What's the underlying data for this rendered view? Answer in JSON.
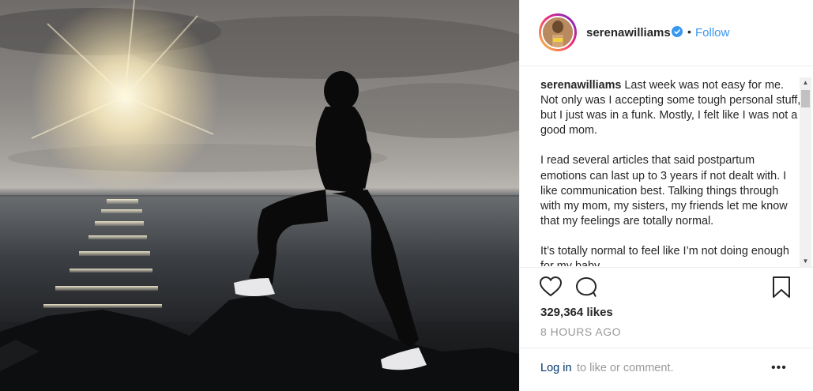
{
  "post": {
    "username": "serenawilliams",
    "follow_label": "Follow",
    "dot": "•",
    "caption": "Last week was not easy for me. Not only was I accepting some tough personal stuff, but I just was in a funk. Mostly, I felt like I was not a good mom.\n\nI read several articles that said postpartum emotions can last up to 3 years if not dealt with. I like communication best. Talking things through with my mom, my sisters, my friends let me know that my feelings are totally normal.\n\nIt’s totally normal to feel like I’m not doing enough for my baby.",
    "likes": "329,364 likes",
    "time_ago": "8 HOURS AGO"
  },
  "footer": {
    "login_link": "Log in",
    "login_rest": "to like or comment.",
    "more_label": "•••"
  },
  "icons": {
    "like": "heart-icon",
    "comment": "comment-icon",
    "save": "bookmark-icon",
    "verified": "verified-badge-icon"
  },
  "colors": {
    "link": "#3897f0",
    "verified": "#3897f0",
    "login": "#003569",
    "muted": "#999999"
  }
}
